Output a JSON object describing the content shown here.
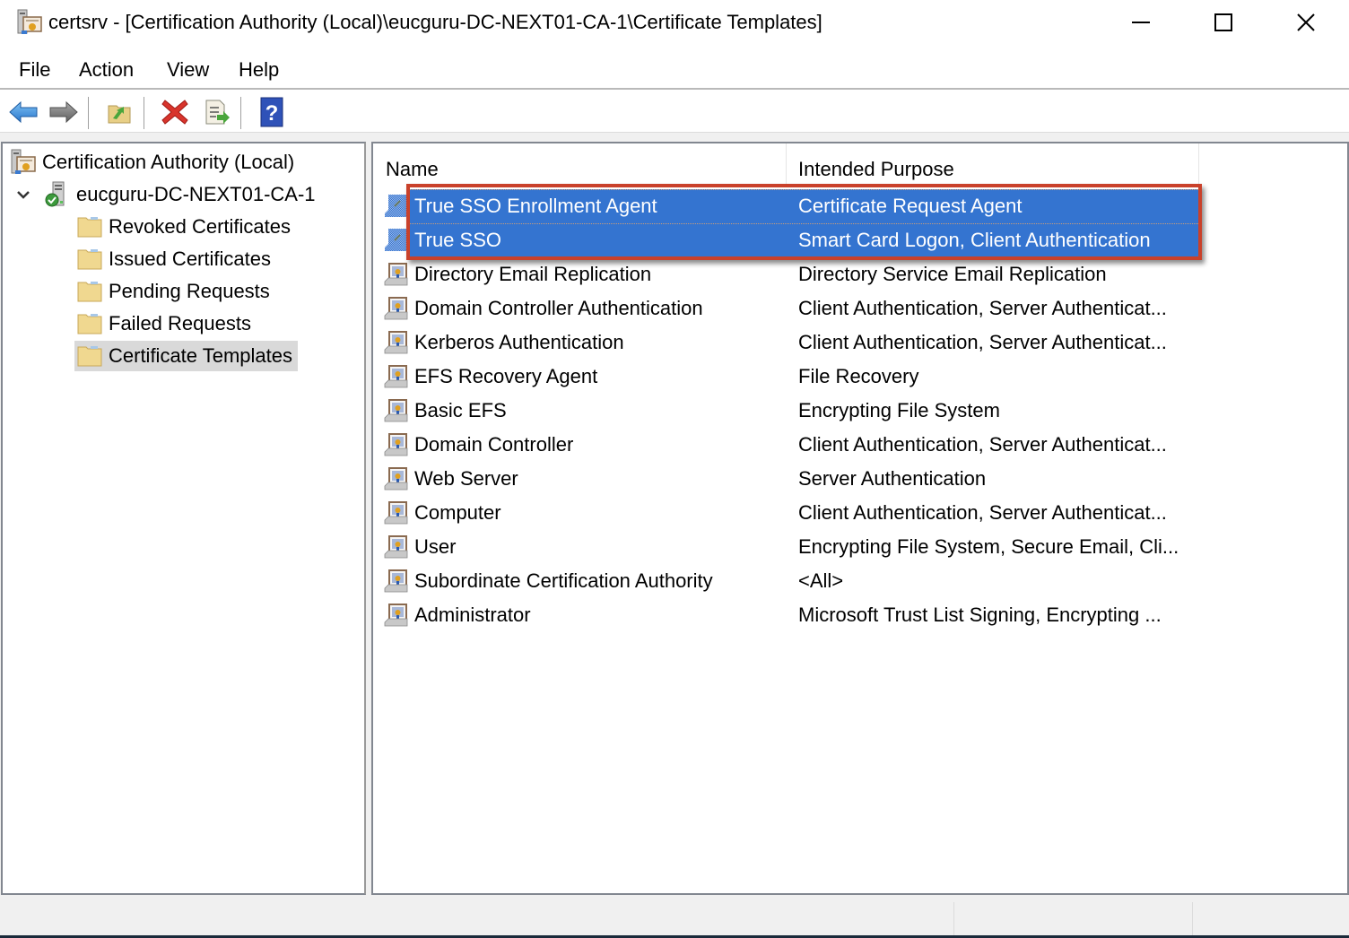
{
  "window": {
    "title": "certsrv - [Certification Authority (Local)\\eucguru-DC-NEXT01-CA-1\\Certificate Templates]",
    "controls": {
      "minimize": "minimize",
      "maximize": "maximize",
      "close": "close"
    }
  },
  "menubar": {
    "items": [
      {
        "label": "File"
      },
      {
        "label": "Action"
      },
      {
        "label": "View"
      },
      {
        "label": "Help"
      }
    ]
  },
  "toolbar": {
    "buttons": [
      {
        "name": "back",
        "icon": "back-arrow-icon"
      },
      {
        "name": "forward",
        "icon": "forward-arrow-icon"
      },
      {
        "name": "up-one-level",
        "icon": "folder-up-icon"
      },
      {
        "name": "delete",
        "icon": "delete-x-icon"
      },
      {
        "name": "export-list",
        "icon": "export-list-icon"
      },
      {
        "name": "help",
        "icon": "help-icon"
      }
    ]
  },
  "tree": {
    "root": {
      "label": "Certification Authority (Local)",
      "icon": "certification-authority-icon"
    },
    "ca": {
      "label": "eucguru-DC-NEXT01-CA-1",
      "icon": "ca-server-icon",
      "expanded": true
    },
    "children": [
      {
        "label": "Revoked Certificates",
        "icon": "folder-icon",
        "selected": false
      },
      {
        "label": "Issued Certificates",
        "icon": "folder-icon",
        "selected": false
      },
      {
        "label": "Pending Requests",
        "icon": "folder-icon",
        "selected": false
      },
      {
        "label": "Failed Requests",
        "icon": "folder-icon",
        "selected": false
      },
      {
        "label": "Certificate Templates",
        "icon": "folder-icon",
        "selected": true
      }
    ]
  },
  "list": {
    "columns": {
      "name": "Name",
      "purpose": "Intended Purpose"
    },
    "rows": [
      {
        "name": "True SSO Enrollment Agent",
        "purpose": "Certificate Request Agent",
        "selected": true
      },
      {
        "name": "True SSO",
        "purpose": "Smart Card Logon, Client Authentication",
        "selected": true
      },
      {
        "name": "Directory Email Replication",
        "purpose": "Directory Service Email Replication",
        "selected": false
      },
      {
        "name": "Domain Controller Authentication",
        "purpose": "Client Authentication, Server Authenticat...",
        "selected": false
      },
      {
        "name": "Kerberos Authentication",
        "purpose": "Client Authentication, Server Authenticat...",
        "selected": false
      },
      {
        "name": "EFS Recovery Agent",
        "purpose": "File Recovery",
        "selected": false
      },
      {
        "name": "Basic EFS",
        "purpose": "Encrypting File System",
        "selected": false
      },
      {
        "name": "Domain Controller",
        "purpose": "Client Authentication, Server Authenticat...",
        "selected": false
      },
      {
        "name": "Web Server",
        "purpose": "Server Authentication",
        "selected": false
      },
      {
        "name": "Computer",
        "purpose": "Client Authentication, Server Authenticat...",
        "selected": false
      },
      {
        "name": "User",
        "purpose": "Encrypting File System, Secure Email, Cli...",
        "selected": false
      },
      {
        "name": "Subordinate Certification Authority",
        "purpose": "<All>",
        "selected": false
      },
      {
        "name": "Administrator",
        "purpose": "Microsoft Trust List Signing, Encrypting ...",
        "selected": false
      }
    ],
    "annotation_color": "#c9412b",
    "selection_color": "#3474d0"
  },
  "statusbar": {
    "panels": [
      "",
      "",
      ""
    ]
  }
}
